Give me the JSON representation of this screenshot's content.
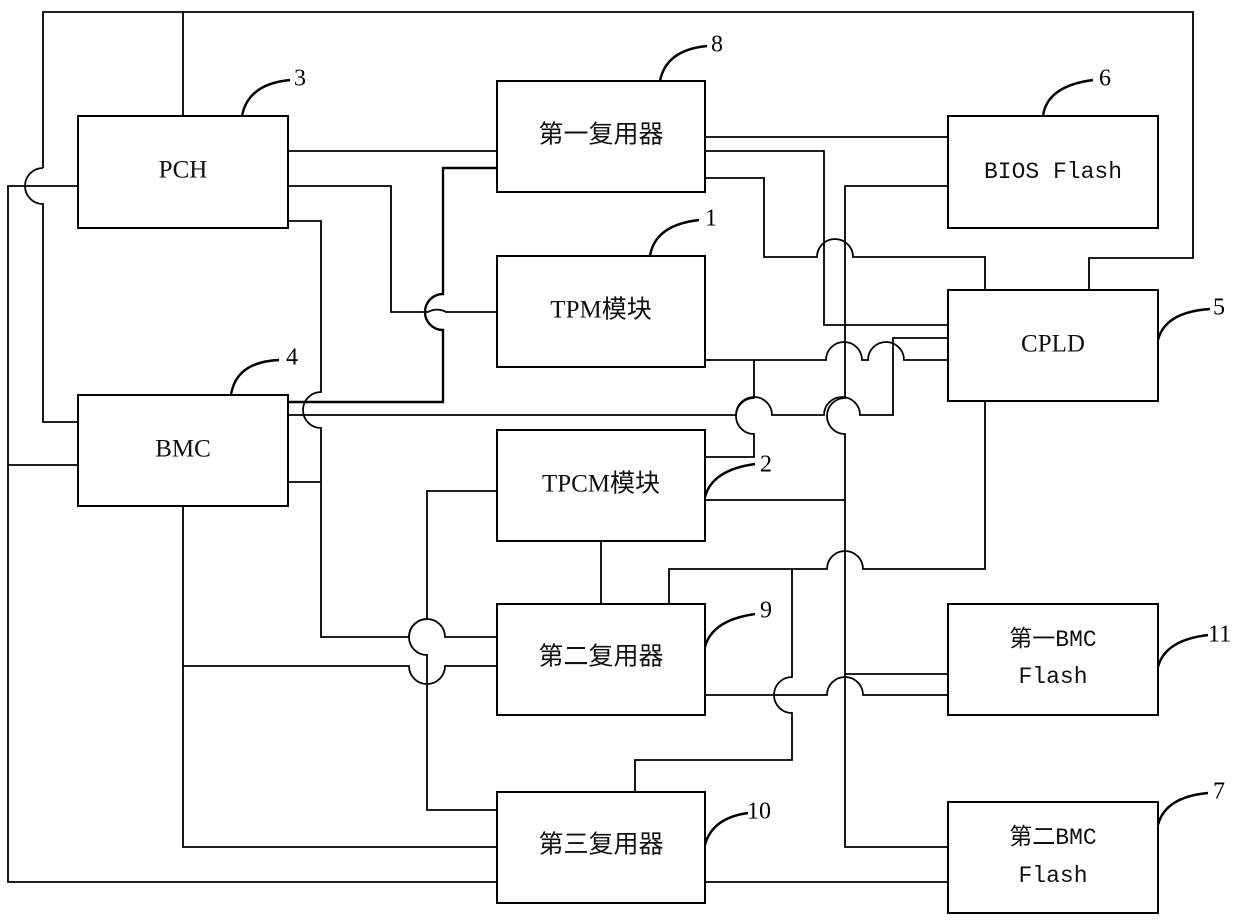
{
  "diagram": {
    "blocks": [
      {
        "id": "pch",
        "label": "PCH",
        "ref": "3"
      },
      {
        "id": "bmc",
        "label": "BMC",
        "ref": "4"
      },
      {
        "id": "mux1",
        "label": "第一复用器",
        "ref": "8"
      },
      {
        "id": "tpm",
        "label": "TPM模块",
        "ref": "1"
      },
      {
        "id": "tpcm",
        "label": "TPCM模块",
        "ref": "2"
      },
      {
        "id": "mux2",
        "label": "第二复用器",
        "ref": "9"
      },
      {
        "id": "mux3",
        "label": "第三复用器",
        "ref": "10"
      },
      {
        "id": "bios",
        "label": "BIOS Flash",
        "ref": "6"
      },
      {
        "id": "cpld",
        "label": "CPLD",
        "ref": "5"
      },
      {
        "id": "bmcflash1",
        "label_line1": "第一BMC",
        "label_line2": "Flash",
        "ref": "11"
      },
      {
        "id": "bmcflash2",
        "label_line1": "第二BMC",
        "label_line2": "Flash",
        "ref": "7"
      }
    ]
  }
}
